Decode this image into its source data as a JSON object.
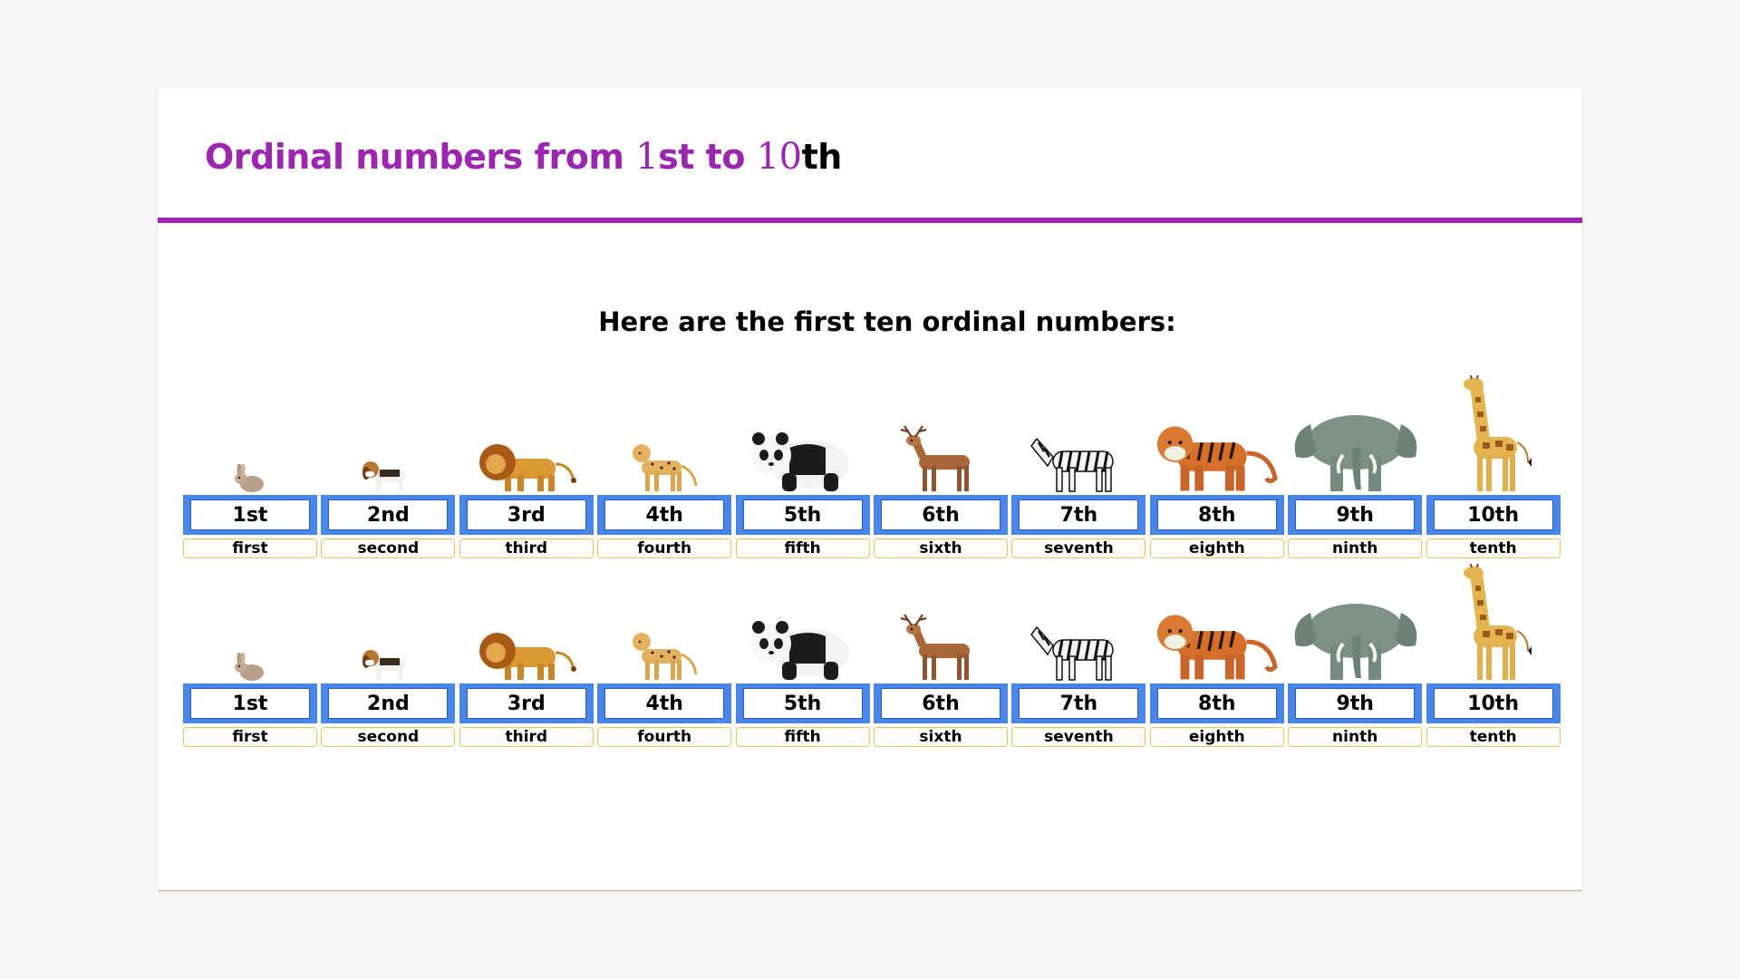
{
  "title": {
    "part1": "Ordinal numbers from ",
    "num1": "1",
    "part2": "st to ",
    "num2": "10",
    "part3": "th"
  },
  "subtitle": "Here are the first ten ordinal numbers:",
  "colors": {
    "accent": "#9b27b0",
    "ordinal_box": "#4a86e8",
    "word_border": "#f0c060"
  },
  "rows": [
    {
      "items": [
        {
          "ordinal": "1st",
          "word": "first",
          "animal": "rabbit-icon"
        },
        {
          "ordinal": "2nd",
          "word": "second",
          "animal": "beagle-icon"
        },
        {
          "ordinal": "3rd",
          "word": "third",
          "animal": "lion-icon"
        },
        {
          "ordinal": "4th",
          "word": "fourth",
          "animal": "cheetah-icon"
        },
        {
          "ordinal": "5th",
          "word": "fifth",
          "animal": "panda-icon"
        },
        {
          "ordinal": "6th",
          "word": "sixth",
          "animal": "deer-icon"
        },
        {
          "ordinal": "7th",
          "word": "seventh",
          "animal": "zebra-icon"
        },
        {
          "ordinal": "8th",
          "word": "eighth",
          "animal": "tiger-icon"
        },
        {
          "ordinal": "9th",
          "word": "ninth",
          "animal": "elephant-icon"
        },
        {
          "ordinal": "10th",
          "word": "tenth",
          "animal": "giraffe-icon"
        }
      ]
    },
    {
      "items": [
        {
          "ordinal": "1st",
          "word": "first",
          "animal": "rabbit-icon"
        },
        {
          "ordinal": "2nd",
          "word": "second",
          "animal": "beagle-icon"
        },
        {
          "ordinal": "3rd",
          "word": "third",
          "animal": "lion-icon"
        },
        {
          "ordinal": "4th",
          "word": "fourth",
          "animal": "cheetah-icon"
        },
        {
          "ordinal": "5th",
          "word": "fifth",
          "animal": "panda-icon"
        },
        {
          "ordinal": "6th",
          "word": "sixth",
          "animal": "deer-icon"
        },
        {
          "ordinal": "7th",
          "word": "seventh",
          "animal": "zebra-icon"
        },
        {
          "ordinal": "8th",
          "word": "eighth",
          "animal": "tiger-icon"
        },
        {
          "ordinal": "9th",
          "word": "ninth",
          "animal": "elephant-icon"
        },
        {
          "ordinal": "10th",
          "word": "tenth",
          "animal": "giraffe-icon"
        }
      ]
    }
  ]
}
